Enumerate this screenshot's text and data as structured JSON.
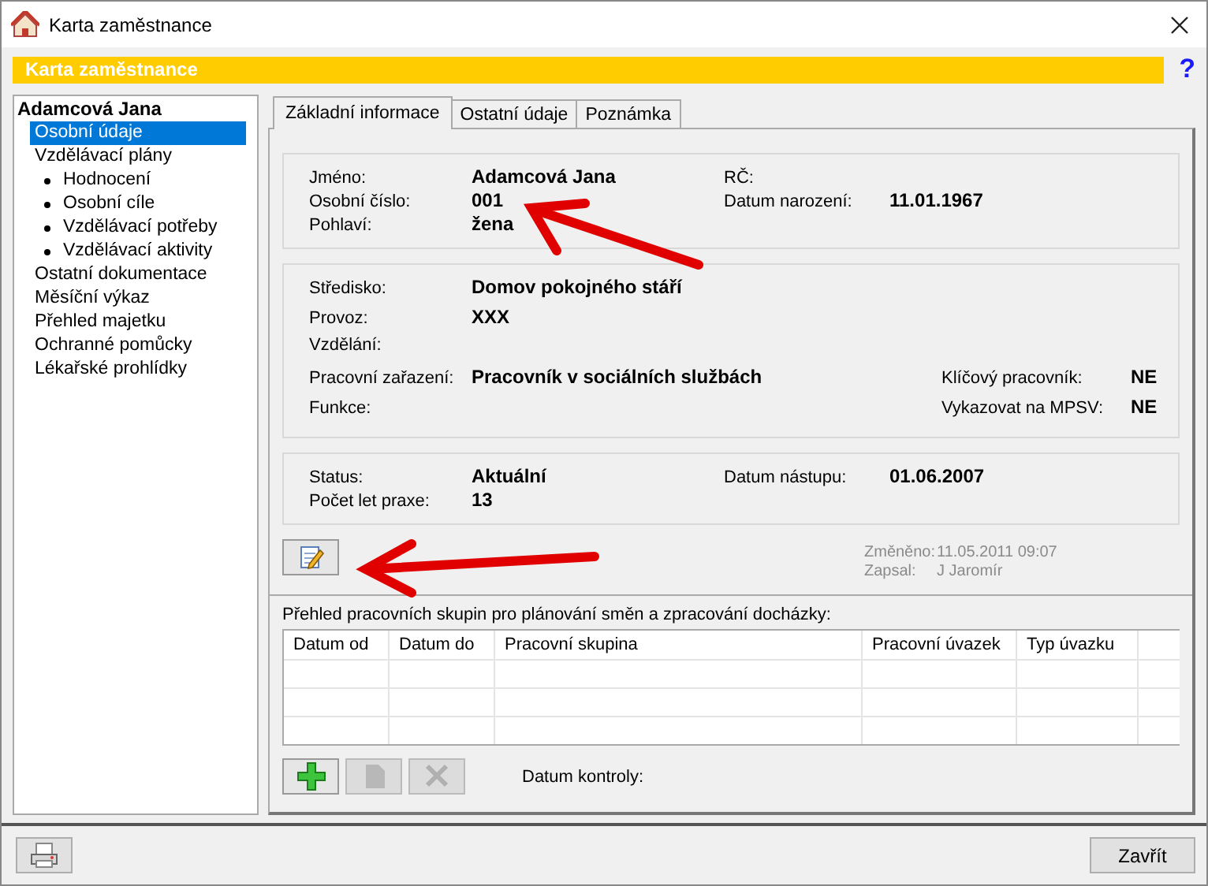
{
  "window": {
    "title": "Karta zaměstnance"
  },
  "banner": {
    "title": "Karta zaměstnance",
    "help": "?"
  },
  "tree": {
    "root": "Adamcová Jana",
    "items": [
      {
        "label": "Osobní údaje",
        "selected": true
      },
      {
        "label": "Vzdělávací plány",
        "selected": false,
        "children": [
          {
            "label": "Hodnocení",
            "selected": false
          },
          {
            "label": "Osobní cíle",
            "selected": false
          },
          {
            "label": "Vzdělávací potřeby",
            "selected": false
          },
          {
            "label": "Vzdělávací aktivity",
            "selected": false
          }
        ]
      },
      {
        "label": "Ostatní dokumentace",
        "selected": false
      },
      {
        "label": "Měsíční výkaz",
        "selected": false
      },
      {
        "label": "Přehled majetku",
        "selected": false
      },
      {
        "label": "Ochranné pomůcky",
        "selected": false
      },
      {
        "label": "Lékařské prohlídky",
        "selected": false
      }
    ]
  },
  "tabs": [
    {
      "label": "Základní informace",
      "selected": true
    },
    {
      "label": "Ostatní údaje",
      "selected": false
    },
    {
      "label": "Poznámka",
      "selected": false
    }
  ],
  "groups": [
    {
      "kind": "basic",
      "rows": [
        {
          "label": "Jméno:",
          "value": "Adamcová Jana",
          "right_label": "RČ:"
        },
        {
          "label": "Osobní číslo:",
          "value": "001",
          "right_label": "Datum narození:",
          "right_value": "11.01.1967"
        },
        {
          "label": "Pohlaví:",
          "value": "žena"
        }
      ]
    },
    {
      "kind": "assignment",
      "rows": [
        {
          "label": "Středisko:",
          "value": "Domov pokojného stáří"
        },
        {
          "label": "Provoz:",
          "value": "XXX"
        },
        {
          "label": "Vzdělání:"
        },
        {
          "label": "Pracovní zařazení:",
          "value": "Pracovník v sociálních službách",
          "right_label": "Klíčový pracovník:",
          "right_value": "NE"
        },
        {
          "label": "Funkce:",
          "right_label": "Vykazovat na MPSV:",
          "right_value": "NE"
        }
      ]
    },
    {
      "kind": "basic",
      "rows": [
        {
          "label": "Status:",
          "value": "Aktuální",
          "right_label": "Datum nástupu:",
          "right_value": "01.06.2007"
        },
        {
          "label": "Počet let praxe:",
          "value": "13"
        }
      ]
    }
  ],
  "audit": [
    {
      "label": "Změněno:",
      "value": "11.05.2011 09:07"
    },
    {
      "label": "Zapsal:",
      "value": "J Jaromír"
    }
  ],
  "workgroups": {
    "caption": "Přehled pracovních skupin pro plánování směn a zpracování docházky:",
    "columns": [
      "Datum od",
      "Datum do",
      "Pracovní skupina",
      "Pracovní úvazek",
      "Typ úvazku"
    ],
    "buttons": [
      {
        "kind": "add",
        "disabled": false
      },
      {
        "kind": "edit",
        "disabled": true
      },
      {
        "kind": "delete",
        "disabled": true
      }
    ],
    "check_label": "Datum kontroly:"
  },
  "footer": {
    "close": "Zavřít"
  }
}
